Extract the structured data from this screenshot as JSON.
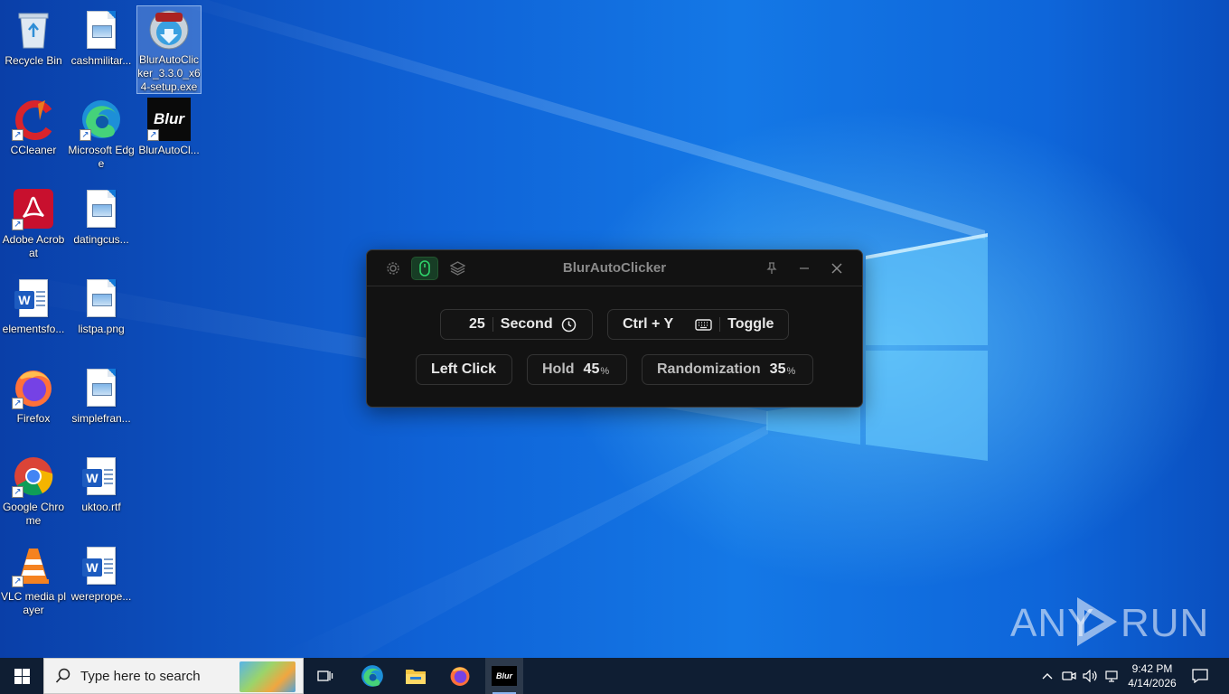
{
  "desktop": {
    "icons": [
      {
        "label": "Recycle Bin"
      },
      {
        "label": "cashmilitar..."
      },
      {
        "label": "BlurAutoClicker_3.3.0_x64-setup.exe"
      },
      {
        "label": "CCleaner"
      },
      {
        "label": "Microsoft Edge"
      },
      {
        "label": "BlurAutoCl..."
      },
      {
        "label": "Adobe Acrobat"
      },
      {
        "label": "datingcus..."
      },
      {
        "label": "elementsfo..."
      },
      {
        "label": "listpa.png"
      },
      {
        "label": "Firefox"
      },
      {
        "label": "simplefran..."
      },
      {
        "label": "Google Chrome"
      },
      {
        "label": "uktoo.rtf"
      },
      {
        "label": "VLC media player"
      },
      {
        "label": "werepropе..."
      }
    ],
    "blur_logo_text": "Blur"
  },
  "app": {
    "title": "BlurAutoClicker",
    "interval_value": "25",
    "interval_unit": "Second",
    "hotkey": "Ctrl + Y",
    "hotkey_mode": "Toggle",
    "click_type": "Left Click",
    "hold_label": "Hold",
    "hold_value": "45",
    "randomization_label": "Randomization",
    "randomization_value": "35",
    "percent_sign": "%",
    "accent_color": "#2fd36b"
  },
  "watermark": {
    "text_left": "ANY",
    "text_right": "RUN"
  },
  "taskbar": {
    "search_placeholder": "Type here to search",
    "blur_label": "Blur",
    "time": "9:42 PM",
    "date": "4/14/2026"
  }
}
